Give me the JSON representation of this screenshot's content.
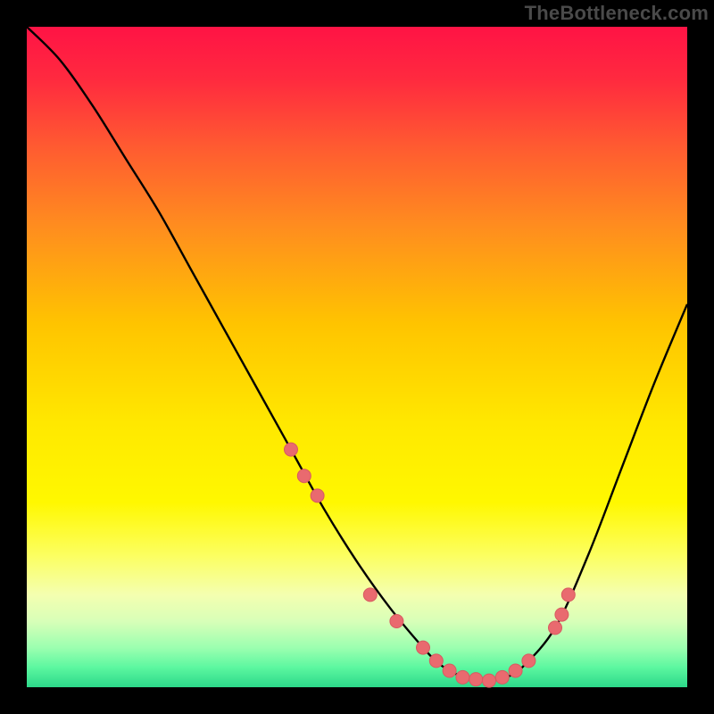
{
  "watermark": "TheBottleneck.com",
  "colors": {
    "background": "#000000",
    "gradient_stops": [
      {
        "pos": 0.0,
        "color": "#ff1345"
      },
      {
        "pos": 0.08,
        "color": "#ff2a3f"
      },
      {
        "pos": 0.18,
        "color": "#ff5a31"
      },
      {
        "pos": 0.3,
        "color": "#ff8c1f"
      },
      {
        "pos": 0.45,
        "color": "#ffc400"
      },
      {
        "pos": 0.6,
        "color": "#ffe800"
      },
      {
        "pos": 0.72,
        "color": "#fff800"
      },
      {
        "pos": 0.8,
        "color": "#fcff60"
      },
      {
        "pos": 0.86,
        "color": "#f4ffb0"
      },
      {
        "pos": 0.9,
        "color": "#d8ffb8"
      },
      {
        "pos": 0.94,
        "color": "#9cffb0"
      },
      {
        "pos": 0.97,
        "color": "#5cf7a0"
      },
      {
        "pos": 1.0,
        "color": "#2cd88a"
      }
    ],
    "curve": "#000000",
    "marker_fill": "#e96a6f",
    "marker_stroke": "#d85a60"
  },
  "chart_data": {
    "type": "line",
    "title": "",
    "xlabel": "",
    "ylabel": "",
    "xlim": [
      0,
      100
    ],
    "ylim": [
      0,
      100
    ],
    "series": [
      {
        "name": "bottleneck-curve",
        "x": [
          0,
          5,
          10,
          15,
          20,
          25,
          30,
          35,
          40,
          45,
          50,
          55,
          60,
          62.5,
          65,
          67.5,
          70,
          72.5,
          75,
          80,
          85,
          90,
          95,
          100
        ],
        "values": [
          100,
          95,
          88,
          80,
          72,
          63,
          54,
          45,
          36,
          27,
          19,
          12,
          6,
          3.5,
          2,
          1.2,
          1,
          1.5,
          3,
          9,
          20,
          33,
          46,
          58
        ]
      }
    ],
    "markers": {
      "name": "highlight-points",
      "x": [
        40,
        42,
        44,
        52,
        56,
        60,
        62,
        64,
        66,
        68,
        70,
        72,
        74,
        76,
        80,
        81,
        82
      ],
      "values": [
        36,
        32,
        29,
        14,
        10,
        6,
        4,
        2.5,
        1.5,
        1.2,
        1,
        1.5,
        2.5,
        4,
        9,
        11,
        14
      ]
    }
  }
}
